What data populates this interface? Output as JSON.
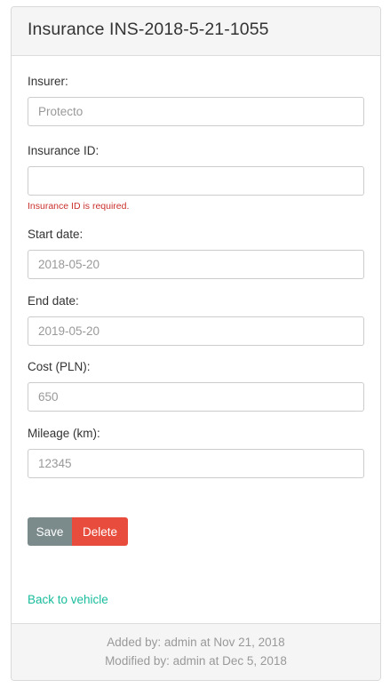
{
  "header": {
    "title": "Insurance INS-2018-5-21-1055"
  },
  "form": {
    "insurer": {
      "label": "Insurer:",
      "placeholder": "Protecto",
      "value": ""
    },
    "insurance_id": {
      "label": "Insurance ID:",
      "placeholder": "",
      "value": "",
      "error": "Insurance ID is required."
    },
    "start_date": {
      "label": "Start date:",
      "placeholder": "2018-05-20",
      "value": ""
    },
    "end_date": {
      "label": "End date:",
      "placeholder": "2019-05-20",
      "value": ""
    },
    "cost": {
      "label": "Cost (PLN):",
      "placeholder": "650",
      "value": ""
    },
    "mileage": {
      "label": "Mileage (km):",
      "placeholder": "12345",
      "value": ""
    }
  },
  "actions": {
    "save_label": "Save",
    "delete_label": "Delete",
    "back_label": "Back to vehicle"
  },
  "footer": {
    "added": "Added by: admin at Nov 21, 2018",
    "modified": "Modified by: admin at Dec 5, 2018"
  },
  "colors": {
    "save": "#7b8a8b",
    "delete": "#e74c3c",
    "link": "#18bc9c",
    "error": "#c9302c"
  }
}
